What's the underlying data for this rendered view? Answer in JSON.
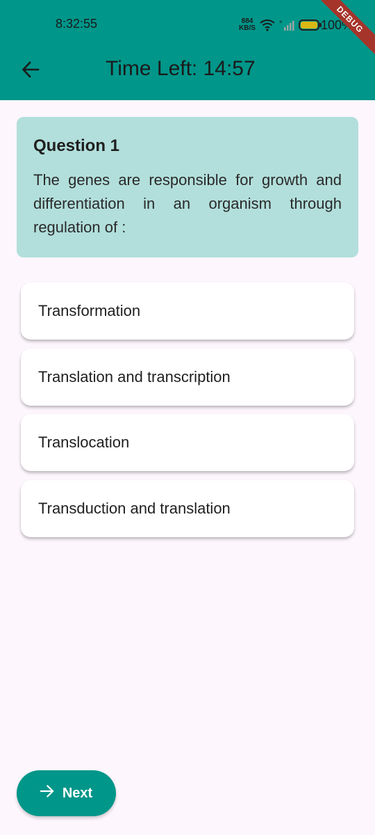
{
  "status_bar": {
    "time": "8:32:55",
    "net_speed_value": "884",
    "net_speed_unit": "KB/S",
    "battery": "100%"
  },
  "debug_banner": "DEBUG",
  "header": {
    "title": "Time Left: 14:57",
    "back_icon": "arrow-back-icon"
  },
  "question": {
    "title": "Question 1",
    "text": "The genes are responsible for growth and differentiation in an organism through regulation of :"
  },
  "options": [
    {
      "label": "Transformation"
    },
    {
      "label": "Translation and transcription"
    },
    {
      "label": "Translocation"
    },
    {
      "label": "Transduction and translation"
    }
  ],
  "next_button": {
    "label": "Next",
    "icon": "arrow-forward-icon"
  },
  "colors": {
    "primary": "#00968a",
    "question_card": "#b2dfdb",
    "background": "#fdf6fd",
    "battery": "#d9b714",
    "debug": "#a5342a"
  }
}
